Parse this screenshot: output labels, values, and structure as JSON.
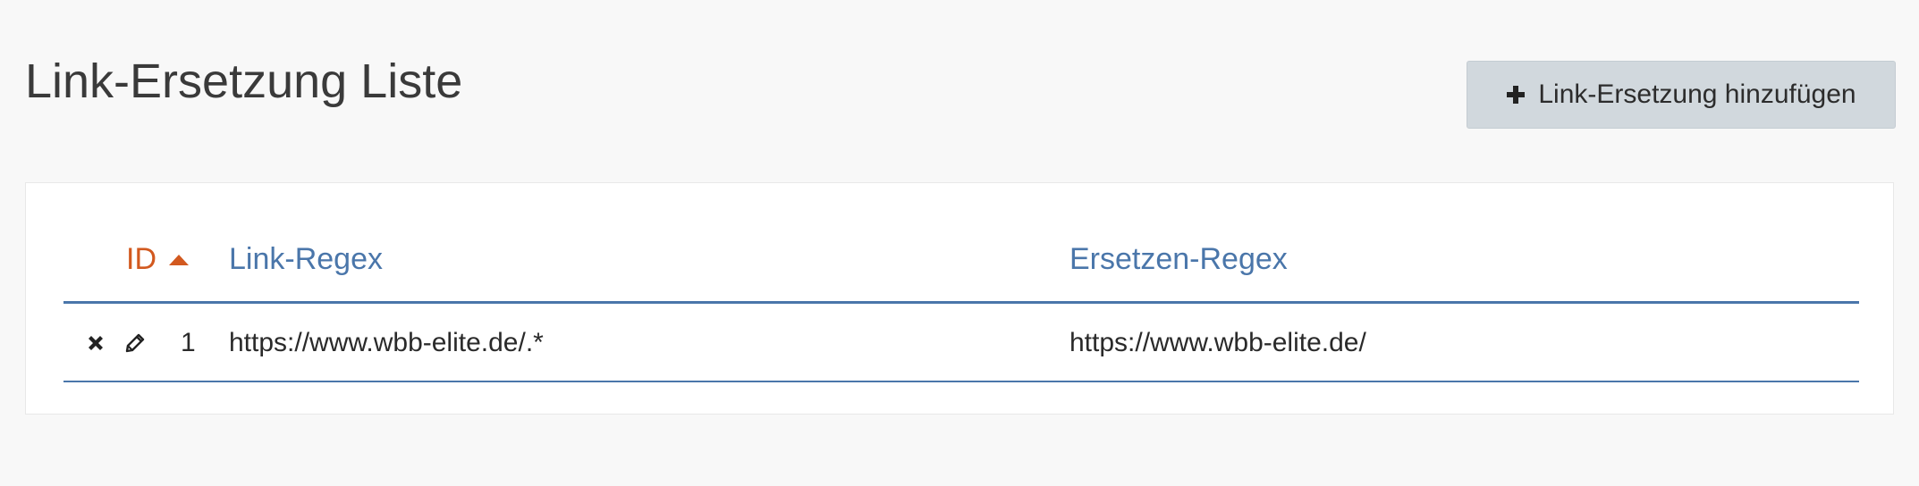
{
  "page": {
    "title": "Link-Ersetzung Liste"
  },
  "toolbar": {
    "add_label": "Link-Ersetzung hinzufügen",
    "add_icon": "plus-icon"
  },
  "table": {
    "columns": [
      {
        "key": "id",
        "label": "ID",
        "sorted": "ascending",
        "color": "#d2591f"
      },
      {
        "key": "link_regex",
        "label": "Link-Regex",
        "color": "#4a76aa"
      },
      {
        "key": "replace_regex",
        "label": "Ersetzen-Regex",
        "color": "#4a76aa"
      }
    ],
    "rows": [
      {
        "actions": [
          "delete-icon",
          "edit-icon"
        ],
        "id": "1",
        "link_regex": "https://www.wbb-elite.de/.*",
        "replace_regex": "https://www.wbb-elite.de/"
      }
    ]
  },
  "colors": {
    "accent": "#4a76aa",
    "sort_active": "#d2591f",
    "button_bg": "#d1d8dd",
    "page_bg": "#f8f8f8"
  }
}
